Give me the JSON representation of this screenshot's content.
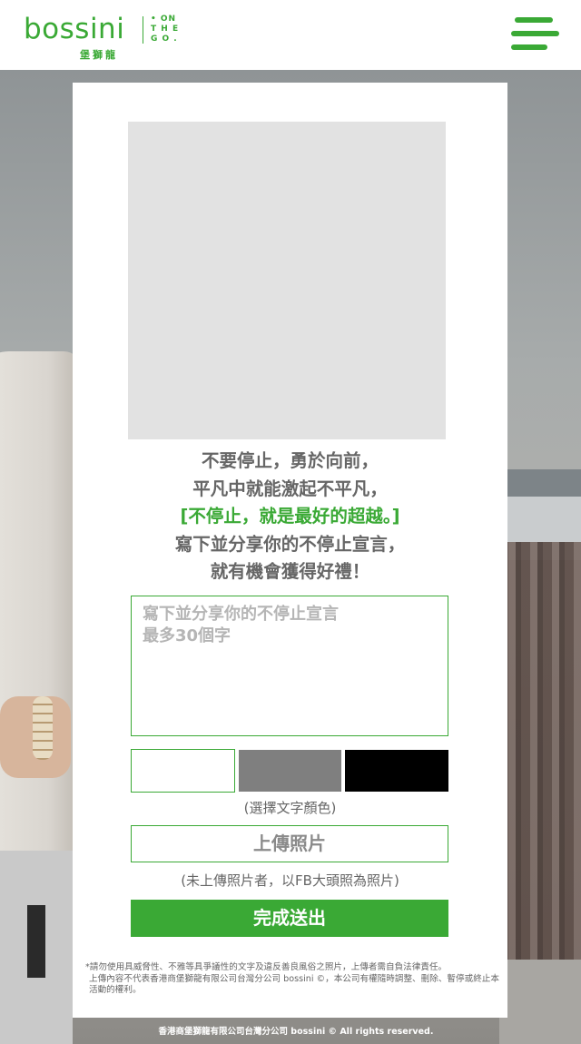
{
  "header": {
    "brand": "bossini",
    "brand_cn": "堡獅龍",
    "tagline_lines": [
      "• ON",
      "T H E",
      "G O ."
    ],
    "menu_icon": "hamburger-menu-icon"
  },
  "form": {
    "slogan_line1": "不要停止，勇於向前，",
    "slogan_line2": "平凡中就能激起不平凡，",
    "slogan_highlight": "[不停止，就是最好的超越。]",
    "slogan_line4": "寫下並分享你的不停止宣言，",
    "slogan_line5": "就有機會獲得好禮！",
    "message_placeholder": "寫下並分享你的不停止宣言\n最多30個字",
    "color_caption": "(選擇文字顏色)",
    "colors": [
      "#ffffff",
      "#7f7f7f",
      "#000000"
    ],
    "upload_label": "上傳照片",
    "upload_caption": "(未上傳照片者，以FB大頭照為照片)",
    "submit_label": "完成送出",
    "disclaimer_line1": "*請勿使用具威脅性、不雅等具爭議性的文字及違反善良風俗之照片，上傳者需自負法律責任。",
    "disclaimer_line2": "上傳內容不代表香港商堡獅龍有限公司台灣分公司 bossini ©，本公司有權隨時調整、刪除、暫停或終止本活動的權利。"
  },
  "footer": {
    "copyright": "香港商堡獅龍有限公司台灣分公司 bossini © All rights reserved."
  },
  "theme": {
    "accent": "#3aa935"
  }
}
